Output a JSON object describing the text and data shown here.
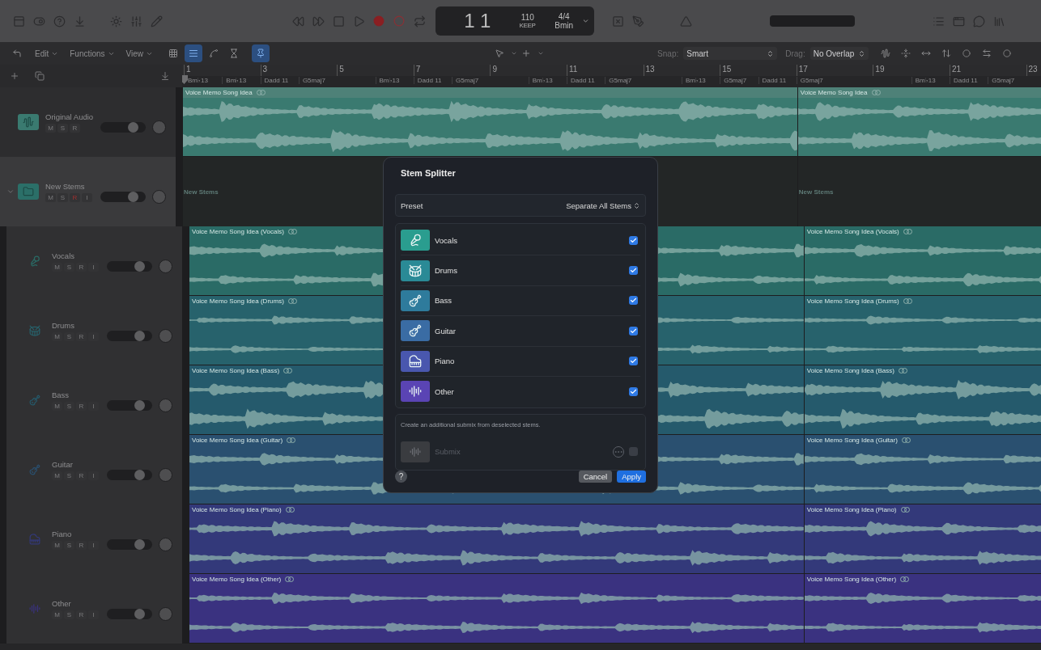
{
  "toolbar": {
    "lcd": {
      "bar": "1",
      "beat": "1",
      "tempo": "110",
      "tempo_mode": "KEEP",
      "signature": "4/4",
      "key": "Bmin"
    }
  },
  "edit_bar": {
    "menus": [
      "Edit",
      "Functions",
      "View"
    ],
    "snap": {
      "label": "Snap:",
      "value": "Smart"
    },
    "drag": {
      "label": "Drag:",
      "value": "No Overlap"
    }
  },
  "ruler": {
    "bars": [
      "1",
      "3",
      "5",
      "7",
      "9",
      "11",
      "13",
      "15",
      "17",
      "19",
      "21",
      "23"
    ],
    "chords": [
      "Bm♭13",
      "Bm♭13",
      "Dadd 11",
      "G5maj7",
      "Bm♭13",
      "Dadd 11",
      "G5maj7",
      "Bm♭13",
      "Dadd 11",
      "G5maj7",
      "Bm♭13",
      "G5maj7",
      "Dadd 11",
      "G5maj7",
      "Bm♭13",
      "Dadd 11",
      "G5maj7"
    ]
  },
  "tracks": [
    {
      "name": "Original Audio",
      "kind": "audio",
      "color": "#3a7a70",
      "buttons": [
        "M",
        "S",
        "R"
      ],
      "armed": false,
      "level": 0.8,
      "regions": [
        "Voice Memo Song Idea",
        "Voice Memo Song Idea"
      ]
    },
    {
      "name": "New Stems",
      "kind": "folder",
      "color": "#2b6f68",
      "buttons": [
        "M",
        "S",
        "R",
        "I"
      ],
      "armed": true,
      "expanded": true,
      "level": 0.8,
      "regions": [
        "New Stems",
        "New Stems"
      ],
      "children": [
        {
          "name": "Vocals",
          "kind": "vocals",
          "color": "#2a6b66",
          "buttons": [
            "M",
            "S",
            "R",
            "I"
          ],
          "armed": false,
          "level": 0.8,
          "regions": [
            "Voice Memo Song Idea (Vocals)",
            "Voice Memo Song Idea (Vocals)"
          ]
        },
        {
          "name": "Drums",
          "kind": "drums",
          "color": "#27626c",
          "buttons": [
            "M",
            "S",
            "R",
            "I"
          ],
          "armed": false,
          "level": 0.8,
          "regions": [
            "Voice Memo Song Idea (Drums)",
            "Voice Memo Song Idea (Drums)"
          ]
        },
        {
          "name": "Bass",
          "kind": "bass",
          "color": "#255a6c",
          "buttons": [
            "M",
            "S",
            "R",
            "I"
          ],
          "armed": false,
          "level": 0.8,
          "regions": [
            "Voice Memo Song Idea (Bass)",
            "Voice Memo Song Idea (Bass)"
          ]
        },
        {
          "name": "Guitar",
          "kind": "guitar",
          "color": "#2a5070",
          "buttons": [
            "M",
            "S",
            "R",
            "I"
          ],
          "armed": false,
          "level": 0.8,
          "regions": [
            "Voice Memo Song Idea (Guitar)",
            "Voice Memo Song Idea (Guitar)"
          ]
        },
        {
          "name": "Piano",
          "kind": "piano",
          "color": "#33397a",
          "buttons": [
            "M",
            "S",
            "R",
            "I"
          ],
          "armed": false,
          "level": 0.8,
          "regions": [
            "Voice Memo Song Idea (Piano)",
            "Voice Memo Song Idea (Piano)"
          ]
        },
        {
          "name": "Other",
          "kind": "other",
          "color": "#3a3280",
          "buttons": [
            "M",
            "S",
            "R",
            "I"
          ],
          "armed": false,
          "level": 0.8,
          "regions": [
            "Voice Memo Song Idea (Other)",
            "Voice Memo Song Idea (Other)"
          ]
        }
      ]
    }
  ],
  "dialog": {
    "title": "Stem Splitter",
    "preset": {
      "label": "Preset",
      "value": "Separate All Stems"
    },
    "stems": [
      {
        "name": "Vocals",
        "kind": "vocals",
        "color": "#2a9d8f",
        "checked": true
      },
      {
        "name": "Drums",
        "kind": "drums",
        "color": "#2a8a96",
        "checked": true
      },
      {
        "name": "Bass",
        "kind": "bass",
        "color": "#2e7b9c",
        "checked": true
      },
      {
        "name": "Guitar",
        "kind": "guitar",
        "color": "#3a6ca4",
        "checked": true
      },
      {
        "name": "Piano",
        "kind": "piano",
        "color": "#4957ae",
        "checked": true
      },
      {
        "name": "Other",
        "kind": "other",
        "color": "#5a44b4",
        "checked": true
      }
    ],
    "submix_note": "Create an additional submix from deselected stems.",
    "submix": {
      "label": "Submix",
      "checked": false,
      "disabled": true
    },
    "help": "?",
    "buttons": {
      "cancel": "Cancel",
      "apply": "Apply"
    }
  }
}
